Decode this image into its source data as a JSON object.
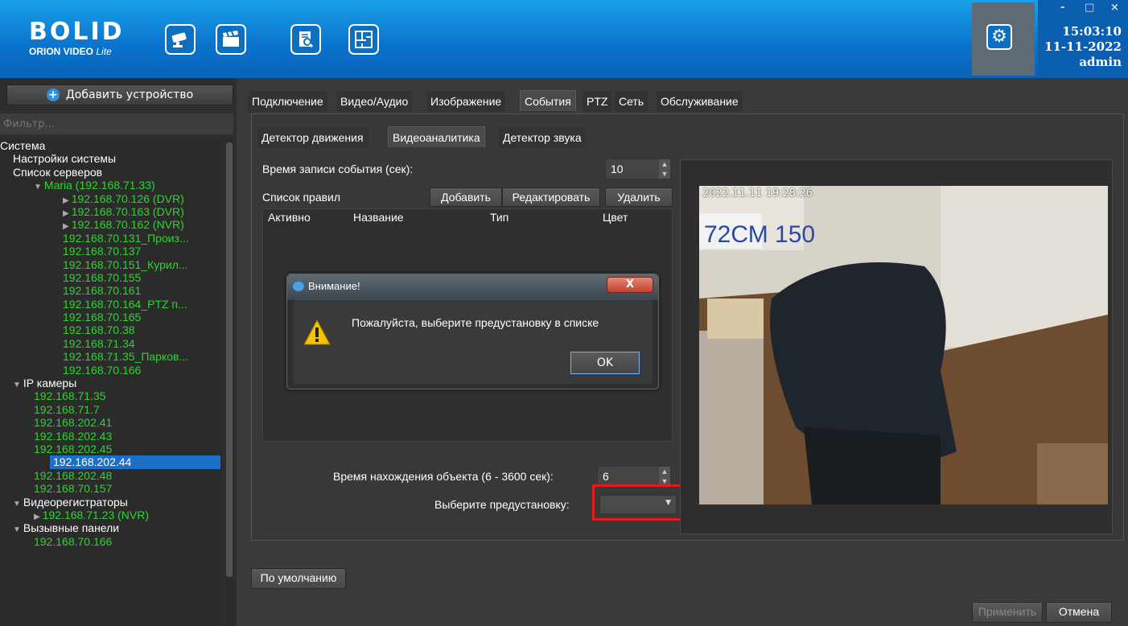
{
  "header": {
    "logo_top": "BOLID",
    "logo_bottom": "ORION VIDEO",
    "logo_suffix": "Lite",
    "icons": [
      "camera-icon",
      "clapperboard-icon",
      "document-search-icon",
      "floor-plan-icon"
    ],
    "settings_icon": "gear-icon",
    "time": "15:03:10",
    "date": "11-11-2022",
    "user": "admin",
    "minimize": "-",
    "maximize": "□",
    "close": "×"
  },
  "sidebar": {
    "add_device": "Добавить устройство",
    "filter_placeholder": "Фильтр...",
    "tree": [
      {
        "label": "Система",
        "indent": 0,
        "color": "w"
      },
      {
        "label": "Настройки системы",
        "indent": 1,
        "color": "w"
      },
      {
        "label": "Список серверов",
        "indent": 1,
        "color": "w"
      },
      {
        "label": "Maria (192.168.71.33)",
        "indent": 2,
        "color": "g",
        "arrow": "▼"
      },
      {
        "label": "192.168.70.126 (DVR)",
        "indent": 3,
        "color": "g",
        "arrow": "▶"
      },
      {
        "label": "192.168.70.163 (DVR)",
        "indent": 3,
        "color": "g",
        "arrow": "▶"
      },
      {
        "label": "192.168.70.162 (NVR)",
        "indent": 3,
        "color": "g",
        "arrow": "▶"
      },
      {
        "label": "192.168.70.131_Произ...",
        "indent": 3,
        "color": "g"
      },
      {
        "label": "192.168.70.137",
        "indent": 3,
        "color": "g"
      },
      {
        "label": "192.168.70.151_Курил...",
        "indent": 3,
        "color": "g"
      },
      {
        "label": "192.168.70.155",
        "indent": 3,
        "color": "g"
      },
      {
        "label": "192.168.70.161",
        "indent": 3,
        "color": "g"
      },
      {
        "label": "192.168.70.164_PTZ п...",
        "indent": 3,
        "color": "g"
      },
      {
        "label": "192.168.70.165",
        "indent": 3,
        "color": "g"
      },
      {
        "label": "192.168.70.38",
        "indent": 3,
        "color": "g"
      },
      {
        "label": "192.168.71.34",
        "indent": 3,
        "color": "g"
      },
      {
        "label": "192.168.71.35_Парков...",
        "indent": 3,
        "color": "g"
      },
      {
        "label": "192.168.70.166",
        "indent": 3,
        "color": "g"
      },
      {
        "label": "IP камеры",
        "indent": 1,
        "color": "w",
        "arrow": "▼"
      },
      {
        "label": "192.168.71.35",
        "indent": 2,
        "color": "g"
      },
      {
        "label": "192.168.71.7",
        "indent": 2,
        "color": "g"
      },
      {
        "label": "192.168.202.41",
        "indent": 2,
        "color": "g"
      },
      {
        "label": "192.168.202.43",
        "indent": 2,
        "color": "g"
      },
      {
        "label": "192.168.202.45",
        "indent": 2,
        "color": "g"
      },
      {
        "label": "192.168.202.44",
        "indent": 2,
        "color": "sel"
      },
      {
        "label": "192.168.202.48",
        "indent": 2,
        "color": "g"
      },
      {
        "label": "192.168.70.157",
        "indent": 2,
        "color": "g"
      },
      {
        "label": "Видеорегистраторы",
        "indent": 1,
        "color": "w",
        "arrow": "▼"
      },
      {
        "label": "192.168.71.23 (NVR)",
        "indent": 2,
        "color": "g",
        "arrow": "▶"
      },
      {
        "label": "Вызывные панели",
        "indent": 1,
        "color": "w",
        "arrow": "▼"
      },
      {
        "label": "192.168.70.166",
        "indent": 2,
        "color": "g"
      }
    ]
  },
  "tabs": [
    "Подключение",
    "Видео/Аудио",
    "Изображение",
    "События",
    "PTZ",
    "Сеть",
    "Обслуживание"
  ],
  "subtabs": [
    "Детектор движения",
    "Видеоаналитика",
    "Детектор звука"
  ],
  "analytics": {
    "event_time_label": "Время записи события (сек):",
    "event_time_value": "10",
    "rules_label": "Список правил",
    "add": "Добавить",
    "edit": "Редактировать",
    "delete": "Удалить",
    "columns": [
      "Активно",
      "Название",
      "Тип",
      "Цвет"
    ],
    "object_time_label": "Время нахождения объекта (6 - 3600 сек):",
    "object_time_value": "6",
    "preset_label": "Выберите предустановку:",
    "preset_value": ""
  },
  "preview": {
    "timestamp": "2022.11.11 19:28:26",
    "sign": "72СМ 150"
  },
  "dialog": {
    "title": "Внимание!",
    "close": "X",
    "message": "Пожалуйста, выберите предустановку в списке",
    "ok": "OK"
  },
  "footer": {
    "default": "По умолчанию",
    "apply": "Применить",
    "cancel": "Отмена"
  },
  "colors": {
    "accent": "#0a72cc",
    "tree_green": "#2ed52e",
    "selection": "#1b6fc6",
    "highlight": "#e21c1c"
  }
}
